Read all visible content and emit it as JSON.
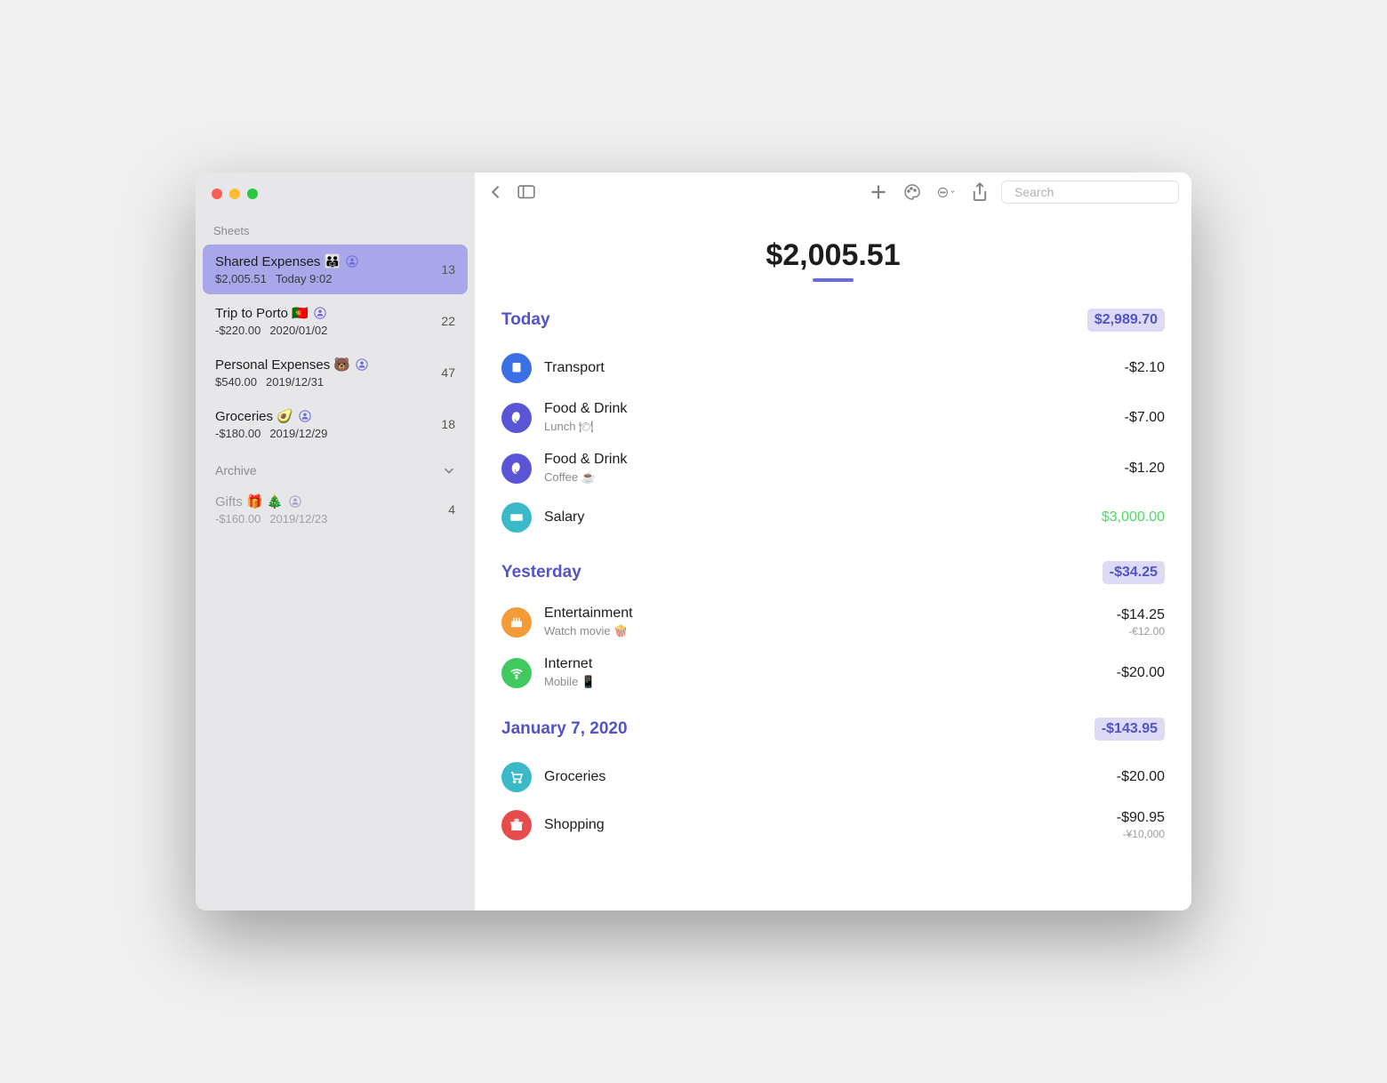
{
  "sidebar": {
    "header": "Sheets",
    "archive_label": "Archive",
    "items": [
      {
        "title": "Shared Expenses 👨‍👨‍👧",
        "amount": "$2,005.51",
        "date": "Today 9:02",
        "count": "13",
        "active": true,
        "shared": true
      },
      {
        "title": "Trip to Porto 🇵🇹",
        "amount": "-$220.00",
        "date": "2020/01/02",
        "count": "22",
        "active": false,
        "shared": true
      },
      {
        "title": "Personal Expenses 🐻",
        "amount": "$540.00",
        "date": "2019/12/31",
        "count": "47",
        "active": false,
        "shared": true
      },
      {
        "title": "Groceries 🥑",
        "amount": "-$180.00",
        "date": "2019/12/29",
        "count": "18",
        "active": false,
        "shared": true
      }
    ],
    "archived_items": [
      {
        "title": "Gifts 🎁 🎄",
        "amount": "-$160.00",
        "date": "2019/12/23",
        "count": "4",
        "shared": true
      }
    ]
  },
  "toolbar": {
    "search_placeholder": "Search"
  },
  "total": "$2,005.51",
  "sections": [
    {
      "title": "Today",
      "sum": "$2,989.70",
      "txs": [
        {
          "category": "Transport",
          "note": "",
          "amount": "-$2.10",
          "amount2": "",
          "color": "#3b6fe6",
          "icon": "transport"
        },
        {
          "category": "Food & Drink",
          "note": "Lunch 🍽",
          "amount": "-$7.00",
          "amount2": "",
          "color": "#5a55d6",
          "icon": "leaf"
        },
        {
          "category": "Food & Drink",
          "note": "Coffee ☕",
          "amount": "-$1.20",
          "amount2": "",
          "color": "#5a55d6",
          "icon": "leaf"
        },
        {
          "category": "Salary",
          "note": "",
          "amount": "$3,000.00",
          "amount2": "",
          "color": "#3bb9c7",
          "icon": "cash",
          "positive": true
        }
      ]
    },
    {
      "title": "Yesterday",
      "sum": "-$34.25",
      "txs": [
        {
          "category": "Entertainment",
          "note": "Watch movie 🍿",
          "amount": "-$14.25",
          "amount2": "-€12.00",
          "color": "#f29b38",
          "icon": "ent"
        },
        {
          "category": "Internet",
          "note": "Mobile 📱",
          "amount": "-$20.00",
          "amount2": "",
          "color": "#3fc95e",
          "icon": "wifi"
        }
      ]
    },
    {
      "title": "January 7, 2020",
      "sum": "-$143.95",
      "txs": [
        {
          "category": "Groceries",
          "note": "",
          "amount": "-$20.00",
          "amount2": "",
          "color": "#3bb9c7",
          "icon": "cart"
        },
        {
          "category": "Shopping",
          "note": "",
          "amount": "-$90.95",
          "amount2": "-¥10,000",
          "color": "#e84b4b",
          "icon": "gift"
        }
      ]
    }
  ]
}
